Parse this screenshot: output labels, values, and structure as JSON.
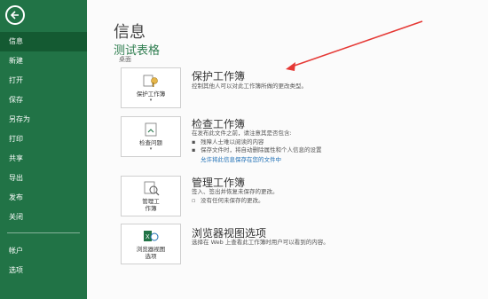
{
  "sidebar": {
    "items": [
      {
        "label": "信息",
        "active": true
      },
      {
        "label": "新建"
      },
      {
        "label": "打开"
      },
      {
        "label": "保存"
      },
      {
        "label": "另存为"
      },
      {
        "label": "打印"
      },
      {
        "label": "共享"
      },
      {
        "label": "导出"
      },
      {
        "label": "发布"
      },
      {
        "label": "关闭"
      },
      {
        "label": "帐户"
      },
      {
        "label": "选项"
      }
    ]
  },
  "main": {
    "title": "信息",
    "file_name": "测试表格",
    "file_location": "桌面",
    "protect": {
      "button_label": "保护工作簿",
      "title": "保护工作簿",
      "desc": "控制其他人可以对此工作簿所做的更改类型。"
    },
    "inspect": {
      "button_label": "检查问题",
      "title": "检查工作簿",
      "desc": "在发布此文件之前，请注意其是否包含:",
      "bullet1": "残障人士难以阅读的内容",
      "bullet2": "保存文件时，将自动删除属性和个人信息的设置",
      "link": "允许将此信息保存在您的文件中"
    },
    "manage": {
      "button_label_1": "管理工",
      "button_label_2": "作簿",
      "title": "管理工作簿",
      "desc": "签入、签出并恢复未保存的更改。",
      "note": "没有任何未保存的更改。"
    },
    "browser": {
      "button_label_1": "浏览器视图",
      "button_label_2": "选项",
      "title": "浏览器视图选项",
      "desc": "选择在 Web 上查看此工作簿时用户可以看到的内容。"
    }
  },
  "colors": {
    "sidebar": "#217346",
    "accent_green": "#2e7d4f",
    "annotation_arrow": "#e53935",
    "link": "#1e6fb5"
  }
}
